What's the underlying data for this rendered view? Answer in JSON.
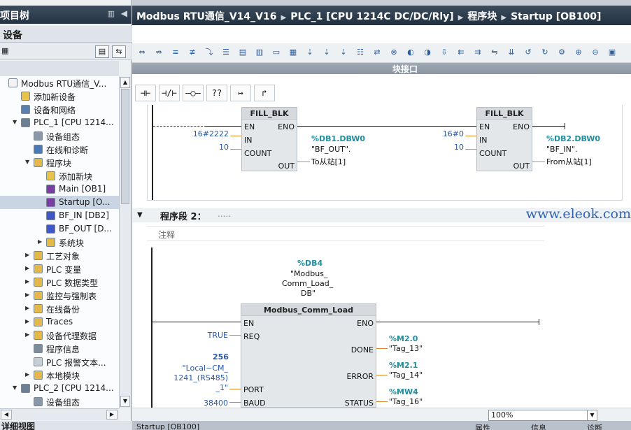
{
  "left_panel": {
    "title": "项目树",
    "section": "设备",
    "bottom": "详细视图",
    "items": [
      {
        "label": "Modbus RTU通信_V...",
        "level": 0,
        "twisty": "",
        "icon": "project-icon"
      },
      {
        "label": "添加新设备",
        "level": 1,
        "twisty": "",
        "icon": "add-device-icon"
      },
      {
        "label": "设备和网络",
        "level": 1,
        "twisty": "",
        "icon": "network-icon"
      },
      {
        "label": "PLC_1 [CPU 1214...",
        "level": 1,
        "twisty": "▼",
        "icon": "plc-icon"
      },
      {
        "label": "设备组态",
        "level": 2,
        "twisty": "",
        "icon": "device-config-icon"
      },
      {
        "label": "在线和诊断",
        "level": 2,
        "twisty": "",
        "icon": "diagnostics-icon"
      },
      {
        "label": "程序块",
        "level": 2,
        "twisty": "▼",
        "icon": "folder-icon"
      },
      {
        "label": "添加新块",
        "level": 3,
        "twisty": "",
        "icon": "add-block-icon"
      },
      {
        "label": "Main [OB1]",
        "level": 3,
        "twisty": "",
        "icon": "ob-icon"
      },
      {
        "label": "Startup [O...",
        "level": 3,
        "twisty": "",
        "icon": "ob-icon",
        "selected": true
      },
      {
        "label": "BF_IN [DB2]",
        "level": 3,
        "twisty": "",
        "icon": "db-icon"
      },
      {
        "label": "BF_OUT [D...",
        "level": 3,
        "twisty": "",
        "icon": "db-icon"
      },
      {
        "label": "系统块",
        "level": 3,
        "twisty": "▶",
        "icon": "folder-icon"
      },
      {
        "label": "工艺对象",
        "level": 2,
        "twisty": "▶",
        "icon": "folder-icon"
      },
      {
        "label": "PLC 变量",
        "level": 2,
        "twisty": "▶",
        "icon": "folder-icon"
      },
      {
        "label": "PLC 数据类型",
        "level": 2,
        "twisty": "▶",
        "icon": "folder-icon"
      },
      {
        "label": "监控与强制表",
        "level": 2,
        "twisty": "▶",
        "icon": "folder-icon"
      },
      {
        "label": "在线备份",
        "level": 2,
        "twisty": "▶",
        "icon": "folder-icon"
      },
      {
        "label": "Traces",
        "level": 2,
        "twisty": "▶",
        "icon": "folder-icon"
      },
      {
        "label": "设备代理数据",
        "level": 2,
        "twisty": "▶",
        "icon": "folder-icon"
      },
      {
        "label": "程序信息",
        "level": 2,
        "twisty": "",
        "icon": "info-icon"
      },
      {
        "label": "PLC 报警文本...",
        "level": 2,
        "twisty": "",
        "icon": "alarm-icon"
      },
      {
        "label": "本地模块",
        "level": 2,
        "twisty": "▶",
        "icon": "folder-icon"
      },
      {
        "label": "PLC_2 [CPU 1214...",
        "level": 1,
        "twisty": "▼",
        "icon": "plc-icon"
      },
      {
        "label": "设备组态",
        "level": 2,
        "twisty": "",
        "icon": "device-config-icon"
      }
    ]
  },
  "breadcrumb": [
    "Modbus RTU通信_V14_V16",
    "PLC_1 [CPU 1214C DC/DC/Rly]",
    "程序块",
    "Startup [OB100]"
  ],
  "interface_bar": "块接口",
  "ladder_tools": [
    "⊣⊢",
    "⊣/⊢",
    "–○–",
    "??",
    "↦",
    "↱"
  ],
  "network1": {
    "blocks": [
      {
        "name": "FILL_BLK",
        "en": "EN",
        "eno": "ENO",
        "in_pin": "IN",
        "count_pin": "COUNT",
        "out_pin": "OUT",
        "in_val": "16#2222",
        "count_val": "10",
        "out_addr": "%DB1.DBW0",
        "out_sym1": "\"BF_OUT\".",
        "out_sym2": "To从站[1]"
      },
      {
        "name": "FILL_BLK",
        "en": "EN",
        "eno": "ENO",
        "in_pin": "IN",
        "count_pin": "COUNT",
        "out_pin": "OUT",
        "in_val": "16#0",
        "count_val": "10",
        "out_addr": "%DB2.DBW0",
        "out_sym1": "\"BF_IN\".",
        "out_sym2": "From从站[1]"
      }
    ]
  },
  "network2": {
    "header": "程序段 2：",
    "header_dots": ".....",
    "comment": "注释",
    "watermark": "www.eleok.com",
    "instance_addr": "%DB4",
    "instance_name": [
      "\"Modbus_",
      "Comm_Load_",
      "DB\""
    ],
    "block_name": "Modbus_Comm_Load",
    "pins_left": [
      "EN",
      "REQ",
      "PORT",
      "BAUD"
    ],
    "pins_right": [
      "ENO",
      "DONE",
      "ERROR",
      "STATUS"
    ],
    "req_val": "TRUE",
    "port_val": "256",
    "port_sym": [
      "\"Local~CM_",
      "1241_(RS485)",
      "_1\""
    ],
    "baud_val": "38400",
    "done_addr": "%M2.0",
    "done_sym": "\"Tag_13\"",
    "error_addr": "%M2.1",
    "error_sym": "\"Tag_14\"",
    "status_addr": "%MW4",
    "status_sym": "\"Tag_16\""
  },
  "status": {
    "zoom": "100%"
  },
  "bottom_tabs": [
    "Startup [OB100]",
    "属性",
    "信息",
    "诊断"
  ]
}
